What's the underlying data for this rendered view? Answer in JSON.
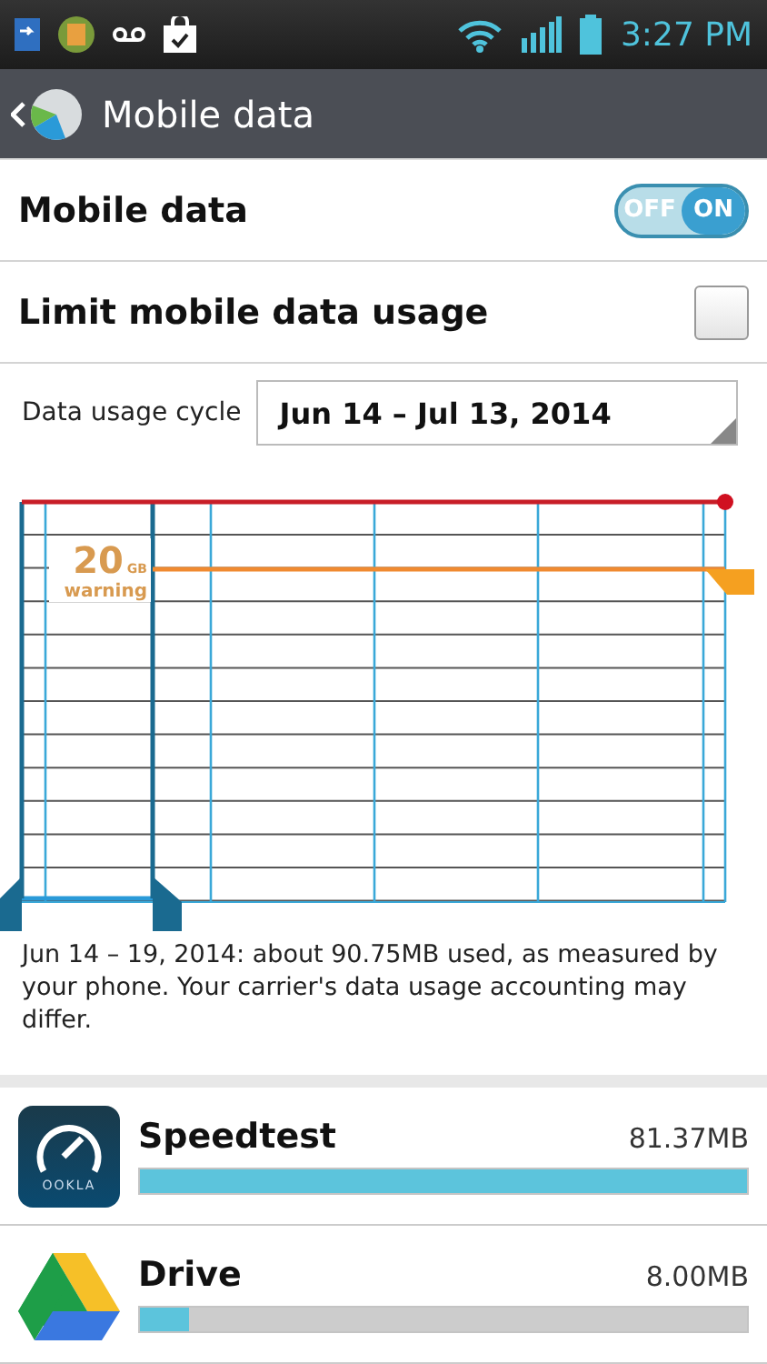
{
  "status_bar": {
    "time": "3:27 PM"
  },
  "action_bar": {
    "title": "Mobile data"
  },
  "settings": [
    {
      "kind": "switch",
      "label": "Mobile data",
      "off_label": "OFF",
      "on_label": "ON",
      "on": true
    },
    {
      "kind": "checkbox",
      "label": "Limit mobile data usage",
      "checked": false
    }
  ],
  "cycle": {
    "label": "Data usage cycle",
    "value": "Jun 14 – Jul 13, 2014"
  },
  "chart": {
    "warning_value": "20",
    "warning_unit": "GB",
    "warning_label": "warning"
  },
  "summary": "Jun 14 – 19, 2014: about 90.75MB used, as measured by your phone. Your carrier's data usage accounting may differ.",
  "apps": [
    {
      "name": "Speedtest",
      "usage": "81.37MB",
      "level": 1.0,
      "kind": "gauge",
      "icon_text": "OOKLA"
    },
    {
      "name": "Drive",
      "usage": "8.00MB",
      "level": 0.08,
      "kind": "triangle"
    }
  ]
}
